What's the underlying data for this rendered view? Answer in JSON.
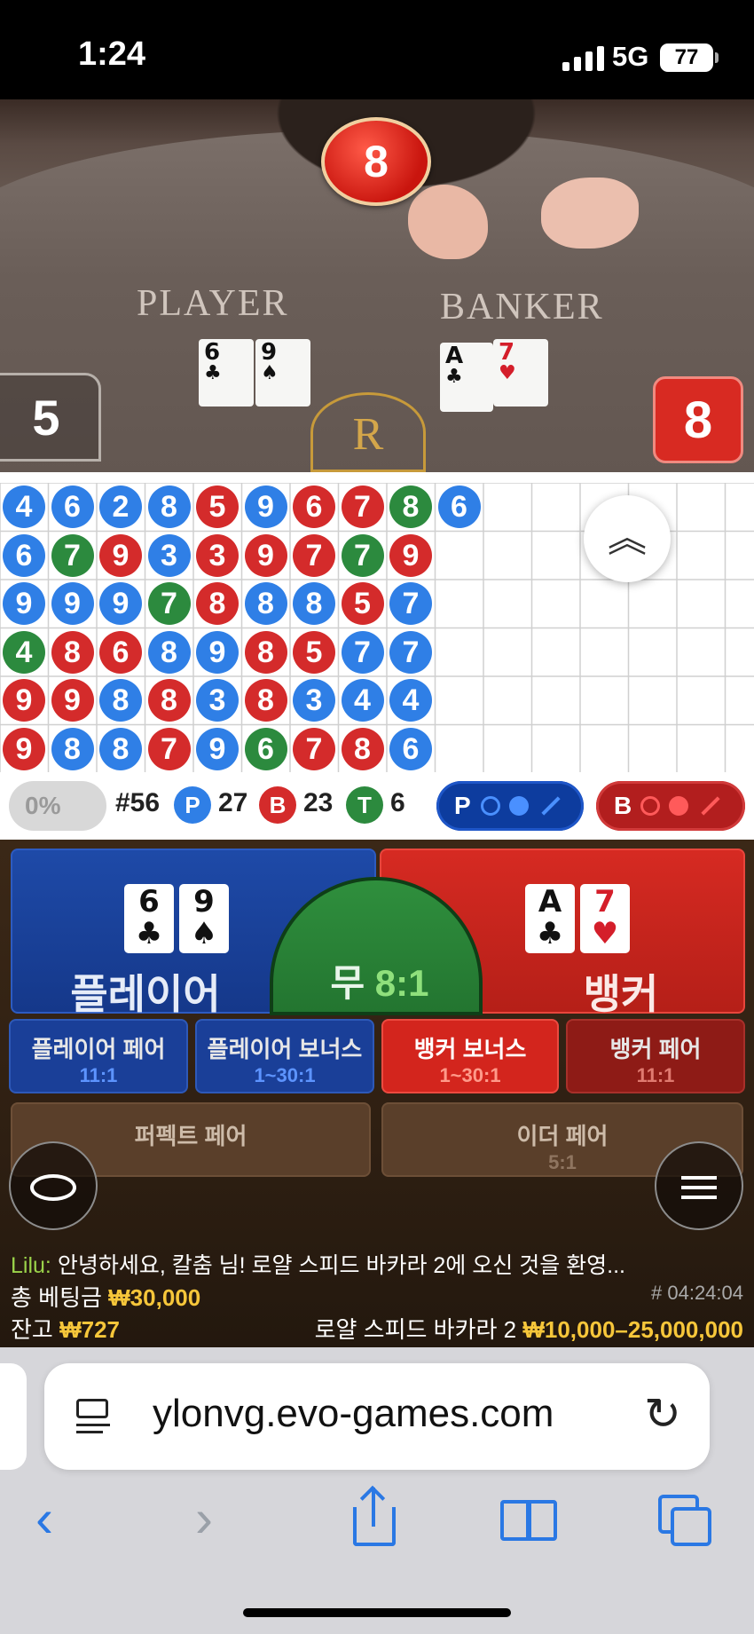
{
  "status_bar": {
    "time": "1:24",
    "network": "5G",
    "battery": "77"
  },
  "video": {
    "top_score": "8",
    "player_label": "PLAYER",
    "banker_label": "BANKER",
    "player_cards": [
      {
        "rank": "6",
        "suit": "♣"
      },
      {
        "rank": "9",
        "suit": "♠"
      }
    ],
    "banker_cards": [
      {
        "rank": "A",
        "suit": "♣"
      },
      {
        "rank": "7",
        "suit": "♥"
      }
    ],
    "player_score": "5",
    "banker_score": "8",
    "table_logo": "R"
  },
  "bead_road": {
    "columns": [
      [
        {
          "v": "4",
          "c": "P"
        },
        {
          "v": "6",
          "c": "P"
        },
        {
          "v": "9",
          "c": "P"
        },
        {
          "v": "4",
          "c": "T"
        },
        {
          "v": "9",
          "c": "B"
        },
        {
          "v": "9",
          "c": "B"
        }
      ],
      [
        {
          "v": "6",
          "c": "P"
        },
        {
          "v": "7",
          "c": "T"
        },
        {
          "v": "9",
          "c": "P"
        },
        {
          "v": "8",
          "c": "B"
        },
        {
          "v": "9",
          "c": "B"
        },
        {
          "v": "8",
          "c": "P"
        }
      ],
      [
        {
          "v": "2",
          "c": "P"
        },
        {
          "v": "9",
          "c": "B"
        },
        {
          "v": "9",
          "c": "P"
        },
        {
          "v": "6",
          "c": "B"
        },
        {
          "v": "8",
          "c": "P"
        },
        {
          "v": "8",
          "c": "P"
        }
      ],
      [
        {
          "v": "8",
          "c": "P"
        },
        {
          "v": "3",
          "c": "P"
        },
        {
          "v": "7",
          "c": "T"
        },
        {
          "v": "8",
          "c": "P"
        },
        {
          "v": "8",
          "c": "B"
        },
        {
          "v": "7",
          "c": "B"
        }
      ],
      [
        {
          "v": "5",
          "c": "B"
        },
        {
          "v": "3",
          "c": "B"
        },
        {
          "v": "8",
          "c": "B"
        },
        {
          "v": "9",
          "c": "P"
        },
        {
          "v": "3",
          "c": "P"
        },
        {
          "v": "9",
          "c": "P"
        }
      ],
      [
        {
          "v": "9",
          "c": "P"
        },
        {
          "v": "9",
          "c": "B"
        },
        {
          "v": "8",
          "c": "P"
        },
        {
          "v": "8",
          "c": "B"
        },
        {
          "v": "8",
          "c": "B"
        },
        {
          "v": "6",
          "c": "T"
        }
      ],
      [
        {
          "v": "6",
          "c": "B"
        },
        {
          "v": "7",
          "c": "B"
        },
        {
          "v": "8",
          "c": "P"
        },
        {
          "v": "5",
          "c": "B"
        },
        {
          "v": "3",
          "c": "P"
        },
        {
          "v": "7",
          "c": "B"
        }
      ],
      [
        {
          "v": "7",
          "c": "B"
        },
        {
          "v": "7",
          "c": "T"
        },
        {
          "v": "5",
          "c": "B"
        },
        {
          "v": "7",
          "c": "P"
        },
        {
          "v": "4",
          "c": "P"
        },
        {
          "v": "8",
          "c": "B"
        }
      ],
      [
        {
          "v": "8",
          "c": "T"
        },
        {
          "v": "9",
          "c": "B"
        },
        {
          "v": "7",
          "c": "P"
        },
        {
          "v": "7",
          "c": "P"
        },
        {
          "v": "4",
          "c": "P"
        },
        {
          "v": "6",
          "c": "P"
        }
      ],
      [
        {
          "v": "6",
          "c": "P"
        }
      ]
    ],
    "expand_icon": "chevron-up-double-icon"
  },
  "stats": {
    "percent": "0%",
    "round": "#56",
    "player_letter": "P",
    "player_count": "27",
    "banker_letter": "B",
    "banker_count": "23",
    "tie_letter": "T",
    "tie_count": "6",
    "player_predict": "P",
    "banker_predict": "B",
    "colors": {
      "player": "#2f7fe6",
      "banker": "#d42b2b",
      "tie": "#2c8a3e"
    }
  },
  "betting": {
    "player_label": "플레이어",
    "tie_label": "무",
    "tie_odds": "8:1",
    "banker_label": "뱅커",
    "player_pair": {
      "label": "플레이어 페어",
      "odds": "11:1"
    },
    "player_bonus": {
      "label": "플레이어 보너스",
      "odds": "1~30:1"
    },
    "banker_bonus": {
      "label": "뱅커 보너스",
      "odds": "1~30:1"
    },
    "banker_pair": {
      "label": "뱅커 페어",
      "odds": "11:1"
    },
    "perfect_pair": {
      "label": "퍼펙트 페어"
    },
    "either_pair": {
      "label": "이더 페어",
      "odds": "5:1"
    }
  },
  "chat": {
    "user": "Lilu:",
    "message": "안녕하세요, 칼춤 님! 로얄 스피드 바카라 2에 오신 것을 환영..."
  },
  "info": {
    "total_bet_label": "총 베팅금",
    "total_bet": "₩30,000",
    "game_id": "# 04:24:04",
    "balance_label": "잔고",
    "balance": "₩727",
    "table_name": "로얄 스피드 바카라 2",
    "limits": "₩10,000–25,000,000"
  },
  "browser": {
    "url": "ylonvg.evo-games.com"
  }
}
